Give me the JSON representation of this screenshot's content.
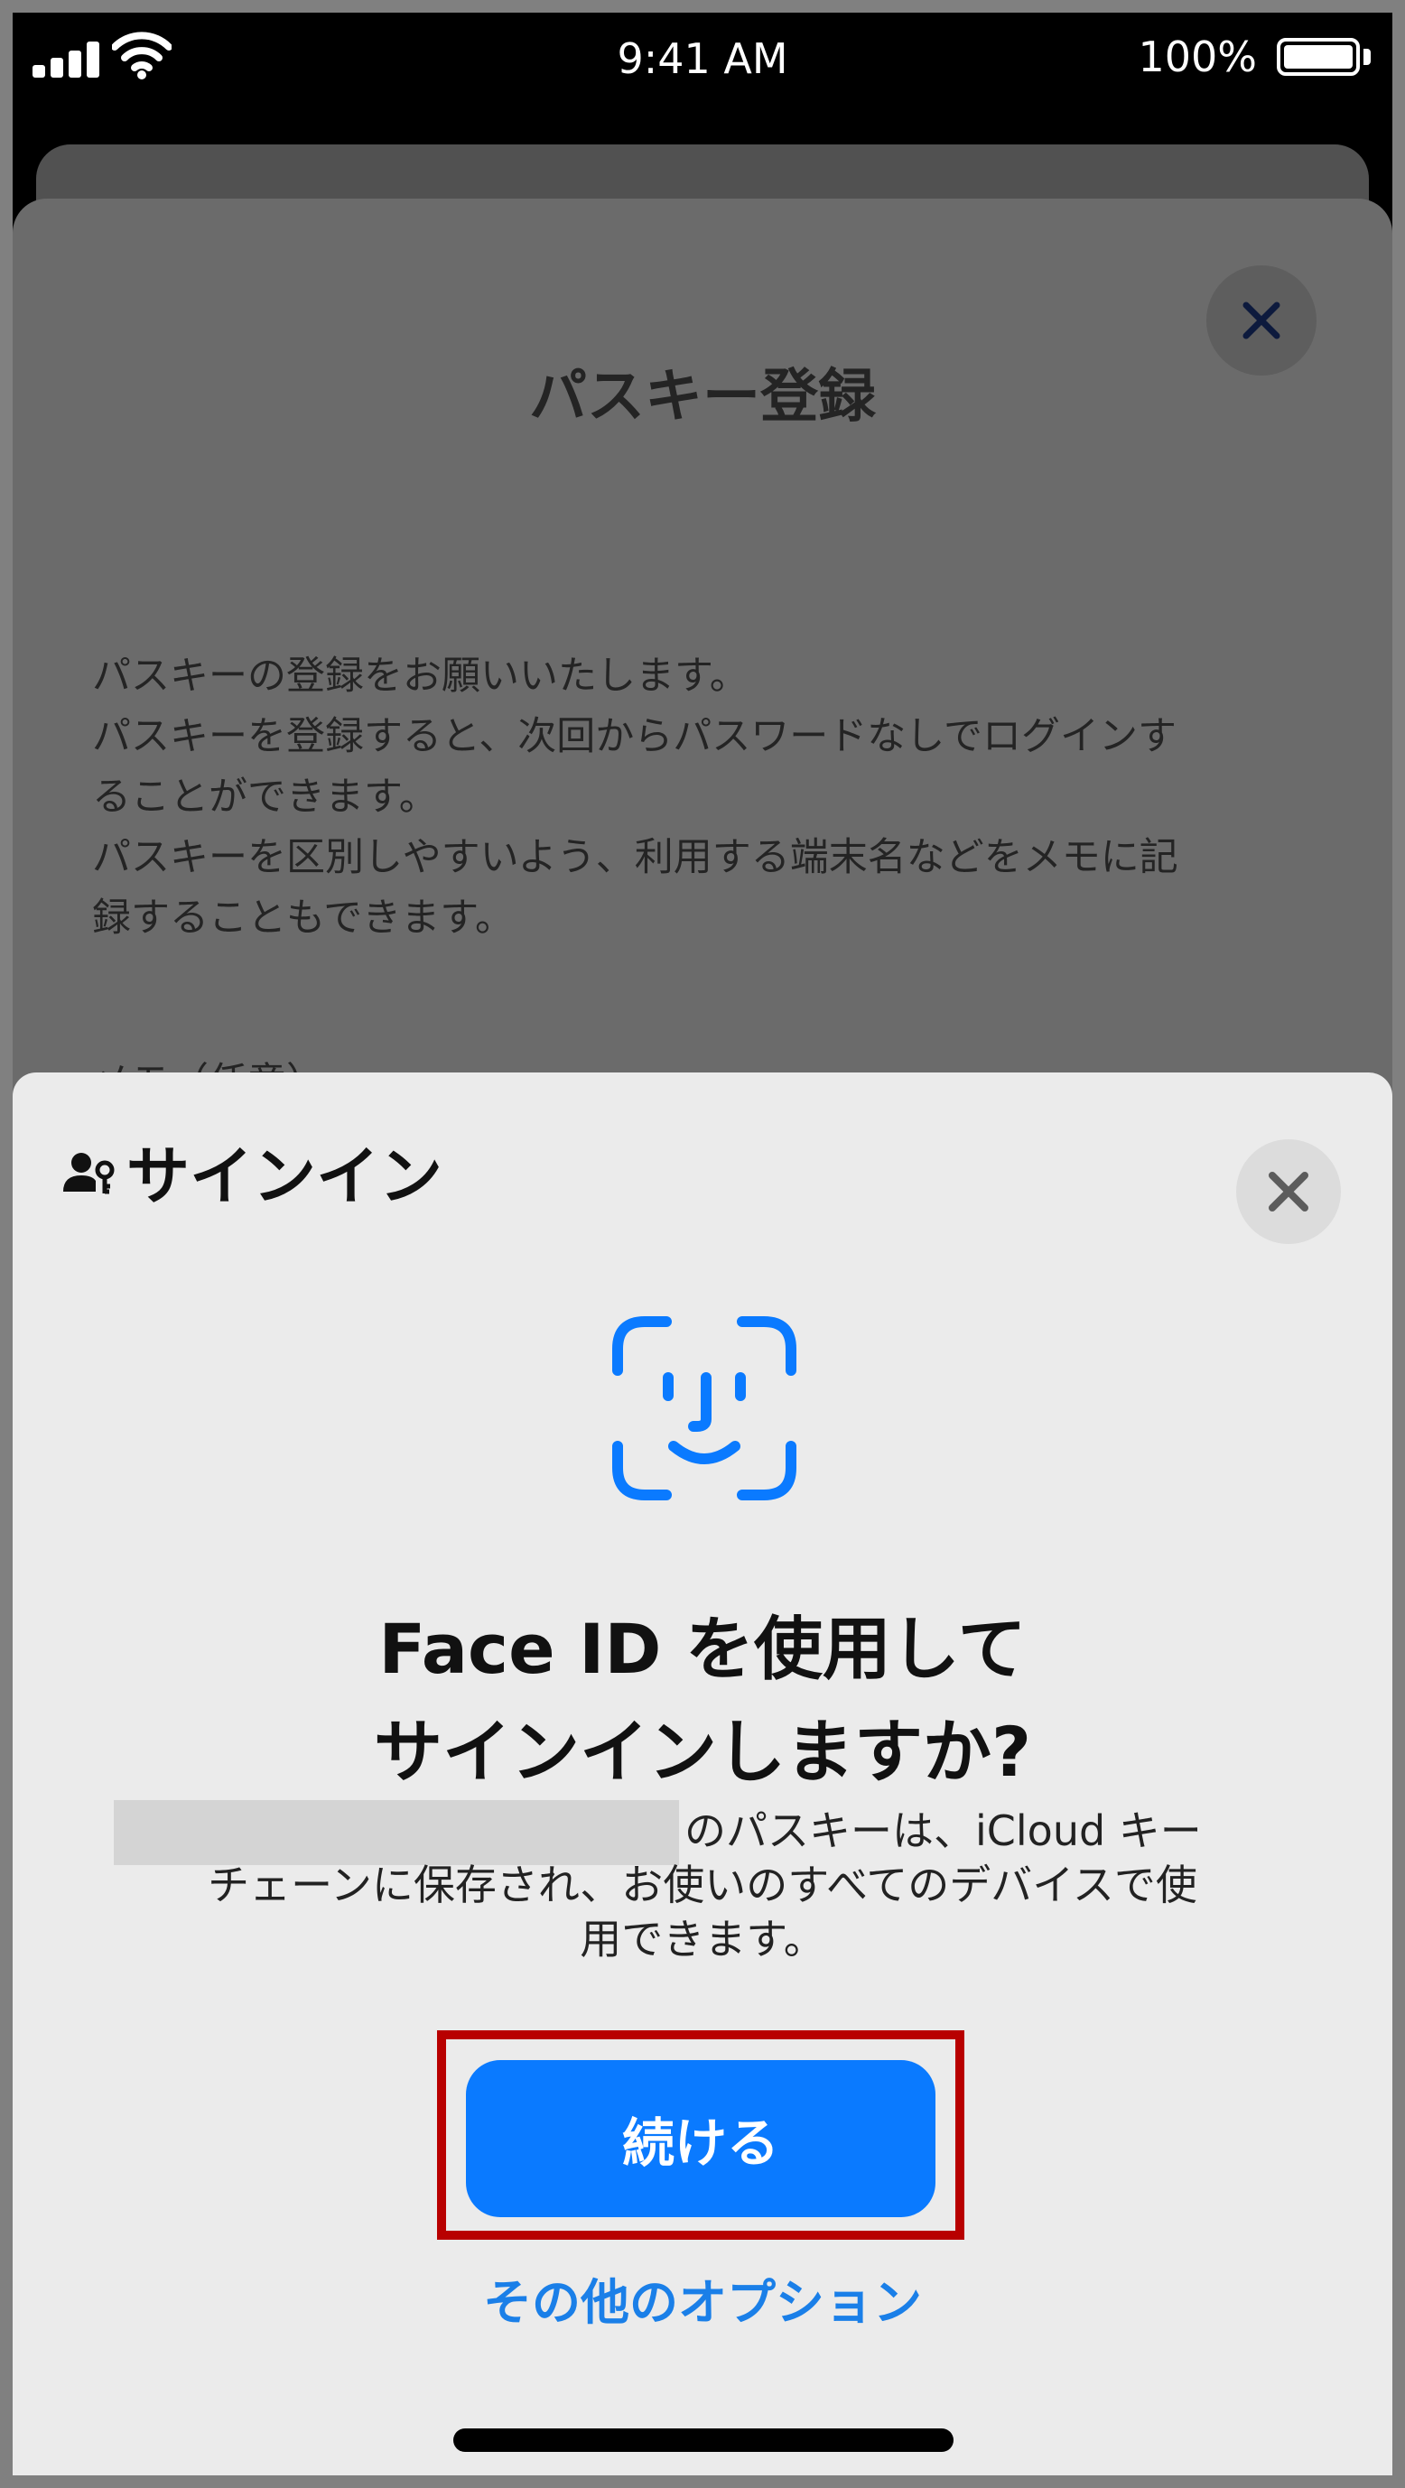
{
  "status_bar": {
    "time": "9:41 AM",
    "battery_percent": "100%",
    "icons": [
      "cellular-signal-icon",
      "wifi-icon",
      "battery-icon"
    ]
  },
  "background_sheet": {
    "title": "パスキー登録",
    "close_icon": "close-icon",
    "body_lines": [
      "パスキーの登録をお願いいたします。",
      "パスキーを登録すると、次回からパスワードなしでログインす",
      "ることができます。",
      "パスキーを区別しやすいよう、利用する端末名などをメモに記",
      "録することもできます。"
    ],
    "memo_label": "メモ（任意）"
  },
  "signin_panel": {
    "title": "サインイン",
    "title_icon": "passkey-person-icon",
    "close_icon": "close-icon",
    "faceid_icon": "face-id-icon",
    "headline_line1": "Face ID を使用して",
    "headline_line2": "サインインしますか?",
    "description_lines": [
      "のパスキーは、iCloud キー",
      "チェーンに保存され、お使いのすべてのデバイスで使",
      "用できます。"
    ],
    "continue_label": "続ける",
    "other_options_label": "その他のオプション"
  },
  "colors": {
    "accent_blue": "#0a7aff",
    "link_blue": "#1a7fe8",
    "highlight_red": "#b80000",
    "panel_bg": "#ebebeb"
  }
}
